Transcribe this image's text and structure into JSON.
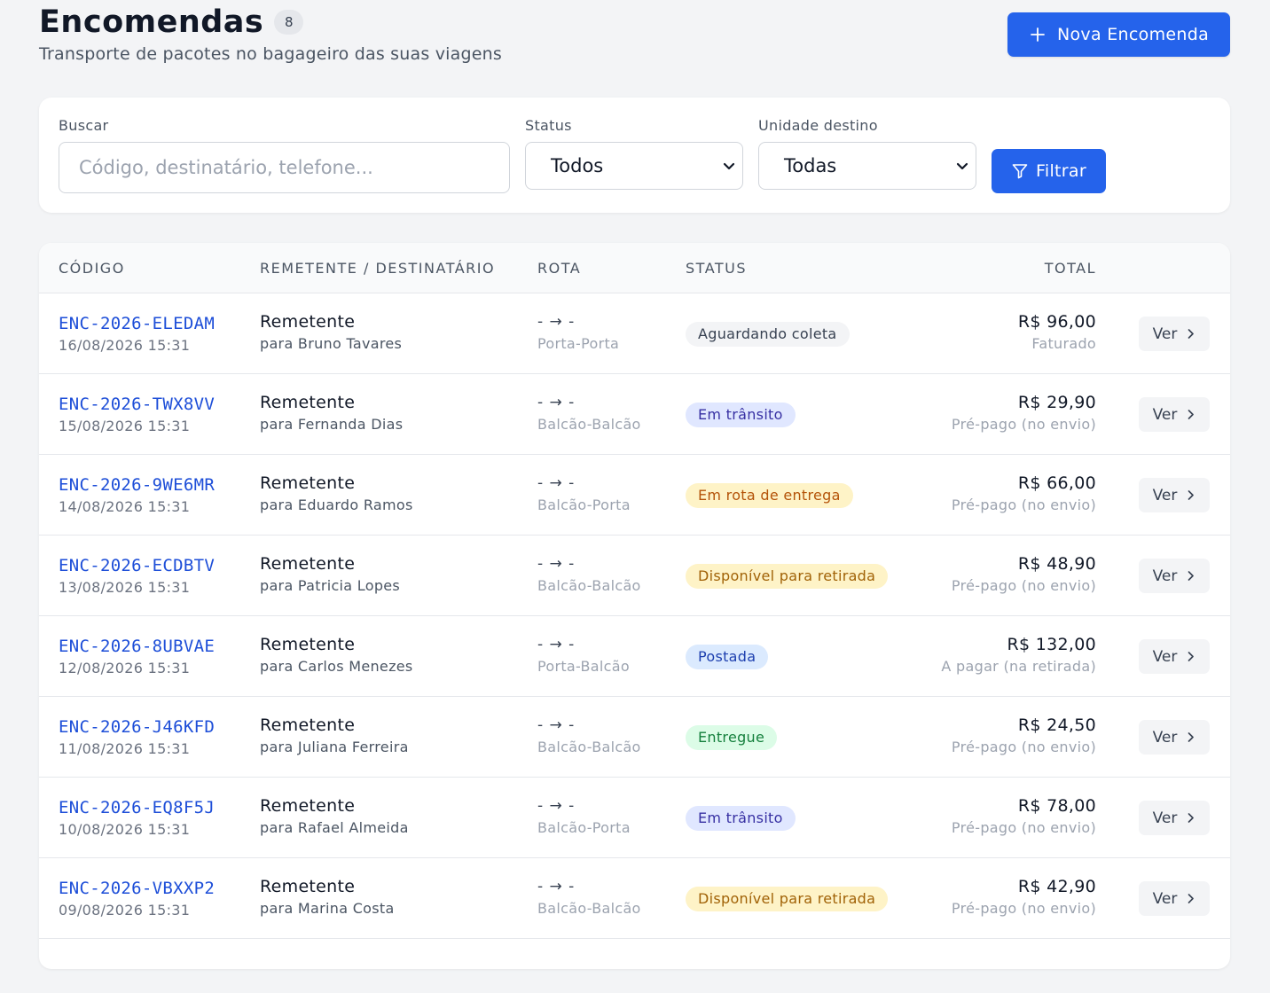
{
  "header": {
    "title": "Encomendas",
    "count": "8",
    "subtitle": "Transporte de pacotes no bagageiro das suas viagens",
    "new_button": "Nova Encomenda"
  },
  "filters": {
    "search_label": "Buscar",
    "search_placeholder": "Código, destinatário, telefone...",
    "search_value": "",
    "status_label": "Status",
    "status_value": "Todos",
    "unit_label": "Unidade destino",
    "unit_value": "Todas",
    "filter_button": "Filtrar"
  },
  "table": {
    "columns": [
      "CÓDIGO",
      "REMETENTE / DESTINATÁRIO",
      "ROTA",
      "STATUS",
      "TOTAL"
    ],
    "view_label": "Ver",
    "rows": [
      {
        "code": "ENC-2026-ELEDAM",
        "date": "16/08/2026 15:31",
        "sender": "Remetente",
        "recipient": "para Bruno Tavares",
        "route": "- → -",
        "route_type": "Porta-Porta",
        "status": "Aguardando coleta",
        "status_kind": "gray",
        "total": "R$ 96,00",
        "payment": "Faturado"
      },
      {
        "code": "ENC-2026-TWX8VV",
        "date": "15/08/2026 15:31",
        "sender": "Remetente",
        "recipient": "para Fernanda Dias",
        "route": "- → -",
        "route_type": "Balcão-Balcão",
        "status": "Em trânsito",
        "status_kind": "indigo",
        "total": "R$ 29,90",
        "payment": "Pré-pago (no envio)"
      },
      {
        "code": "ENC-2026-9WE6MR",
        "date": "14/08/2026 15:31",
        "sender": "Remetente",
        "recipient": "para Eduardo Ramos",
        "route": "- → -",
        "route_type": "Balcão-Porta",
        "status": "Em rota de entrega",
        "status_kind": "amber",
        "total": "R$ 66,00",
        "payment": "Pré-pago (no envio)"
      },
      {
        "code": "ENC-2026-ECDBTV",
        "date": "13/08/2026 15:31",
        "sender": "Remetente",
        "recipient": "para Patricia Lopes",
        "route": "- → -",
        "route_type": "Balcão-Balcão",
        "status": "Disponível para retirada",
        "status_kind": "yellow",
        "total": "R$ 48,90",
        "payment": "Pré-pago (no envio)"
      },
      {
        "code": "ENC-2026-8UBVAE",
        "date": "12/08/2026 15:31",
        "sender": "Remetente",
        "recipient": "para Carlos Menezes",
        "route": "- → -",
        "route_type": "Porta-Balcão",
        "status": "Postada",
        "status_kind": "blue",
        "total": "R$ 132,00",
        "payment": "A pagar (na retirada)"
      },
      {
        "code": "ENC-2026-J46KFD",
        "date": "11/08/2026 15:31",
        "sender": "Remetente",
        "recipient": "para Juliana Ferreira",
        "route": "- → -",
        "route_type": "Balcão-Balcão",
        "status": "Entregue",
        "status_kind": "green",
        "total": "R$ 24,50",
        "payment": "Pré-pago (no envio)"
      },
      {
        "code": "ENC-2026-EQ8F5J",
        "date": "10/08/2026 15:31",
        "sender": "Remetente",
        "recipient": "para Rafael Almeida",
        "route": "- → -",
        "route_type": "Balcão-Porta",
        "status": "Em trânsito",
        "status_kind": "indigo",
        "total": "R$ 78,00",
        "payment": "Pré-pago (no envio)"
      },
      {
        "code": "ENC-2026-VBXXP2",
        "date": "09/08/2026 15:31",
        "sender": "Remetente",
        "recipient": "para Marina Costa",
        "route": "- → -",
        "route_type": "Balcão-Balcão",
        "status": "Disponível para retirada",
        "status_kind": "yellow",
        "total": "R$ 42,90",
        "payment": "Pré-pago (no envio)"
      }
    ]
  },
  "colors": {
    "primary": "#2563eb",
    "link": "#1d4ed8",
    "status": {
      "gray": {
        "bg": "#f3f4f6",
        "fg": "#374151"
      },
      "indigo": {
        "bg": "#e0e7ff",
        "fg": "#3730a3"
      },
      "amber": {
        "bg": "#fef3c7",
        "fg": "#b45309"
      },
      "yellow": {
        "bg": "#fef3c7",
        "fg": "#a16207"
      },
      "blue": {
        "bg": "#dbeafe",
        "fg": "#1e40af"
      },
      "green": {
        "bg": "#dcfce7",
        "fg": "#15803d"
      }
    }
  },
  "icons": {
    "new_button": "plus-icon",
    "filter_button": "filter-icon",
    "select": "chevron-down-icon",
    "view": "chevron-right-icon"
  }
}
